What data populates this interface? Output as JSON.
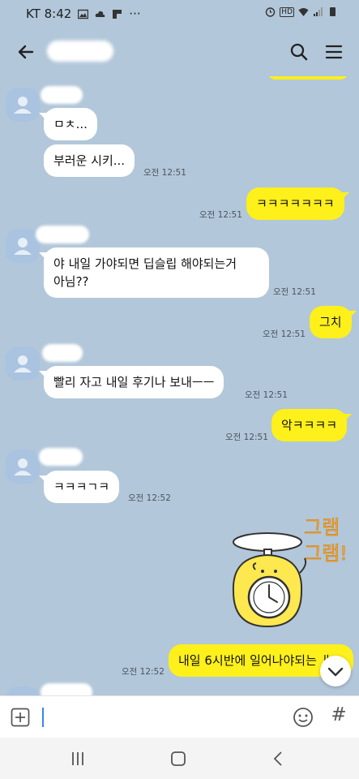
{
  "status_bar": {
    "carrier_time": "KT 8:42",
    "more": "···",
    "hd_badge": "HD"
  },
  "header": {
    "title": "",
    "back_icon": "arrow-left-icon",
    "search_icon": "search-icon",
    "menu_icon": "hamburger-menu-icon"
  },
  "messages": [
    {
      "dir": "in",
      "text": "ㅁㅊ..."
    },
    {
      "dir": "in",
      "text": "부러운 시키...",
      "time": "오전 12:51"
    },
    {
      "dir": "out",
      "text": "ㅋㅋㅋㅋㅋㅋㅋ",
      "time": "오전 12:51"
    },
    {
      "dir": "in",
      "text": "야 내일 가야되면 딥슬립 해야되는거",
      "text2": "아님??",
      "time": "오전 12:51"
    },
    {
      "dir": "out",
      "text": "그치",
      "time": "오전 12:51"
    },
    {
      "dir": "in",
      "text": "빨리 자고 내일 후기나 보내ㅡㅡ",
      "time": "오전 12:51"
    },
    {
      "dir": "out",
      "text": "악ㅋㅋㅋㅋ",
      "time": "오전 12:51"
    },
    {
      "dir": "in",
      "text": "ㅋㅋㅋㄱㅋ",
      "time": "오전 12:52"
    },
    {
      "dir": "out",
      "text": "내일 6시반에 일어나야되는 ㅐ",
      "time": "오전 12:52"
    }
  ],
  "sticker": {
    "line1": "그램",
    "line2": "그램!"
  },
  "input": {
    "value": "",
    "plus_icon": "plus-square-icon",
    "emoji_icon": "emoji-icon",
    "hash": "#"
  },
  "colors": {
    "background": "#b2c7d9",
    "incoming_bubble": "#ffffff",
    "outgoing_bubble": "#fef01b"
  }
}
